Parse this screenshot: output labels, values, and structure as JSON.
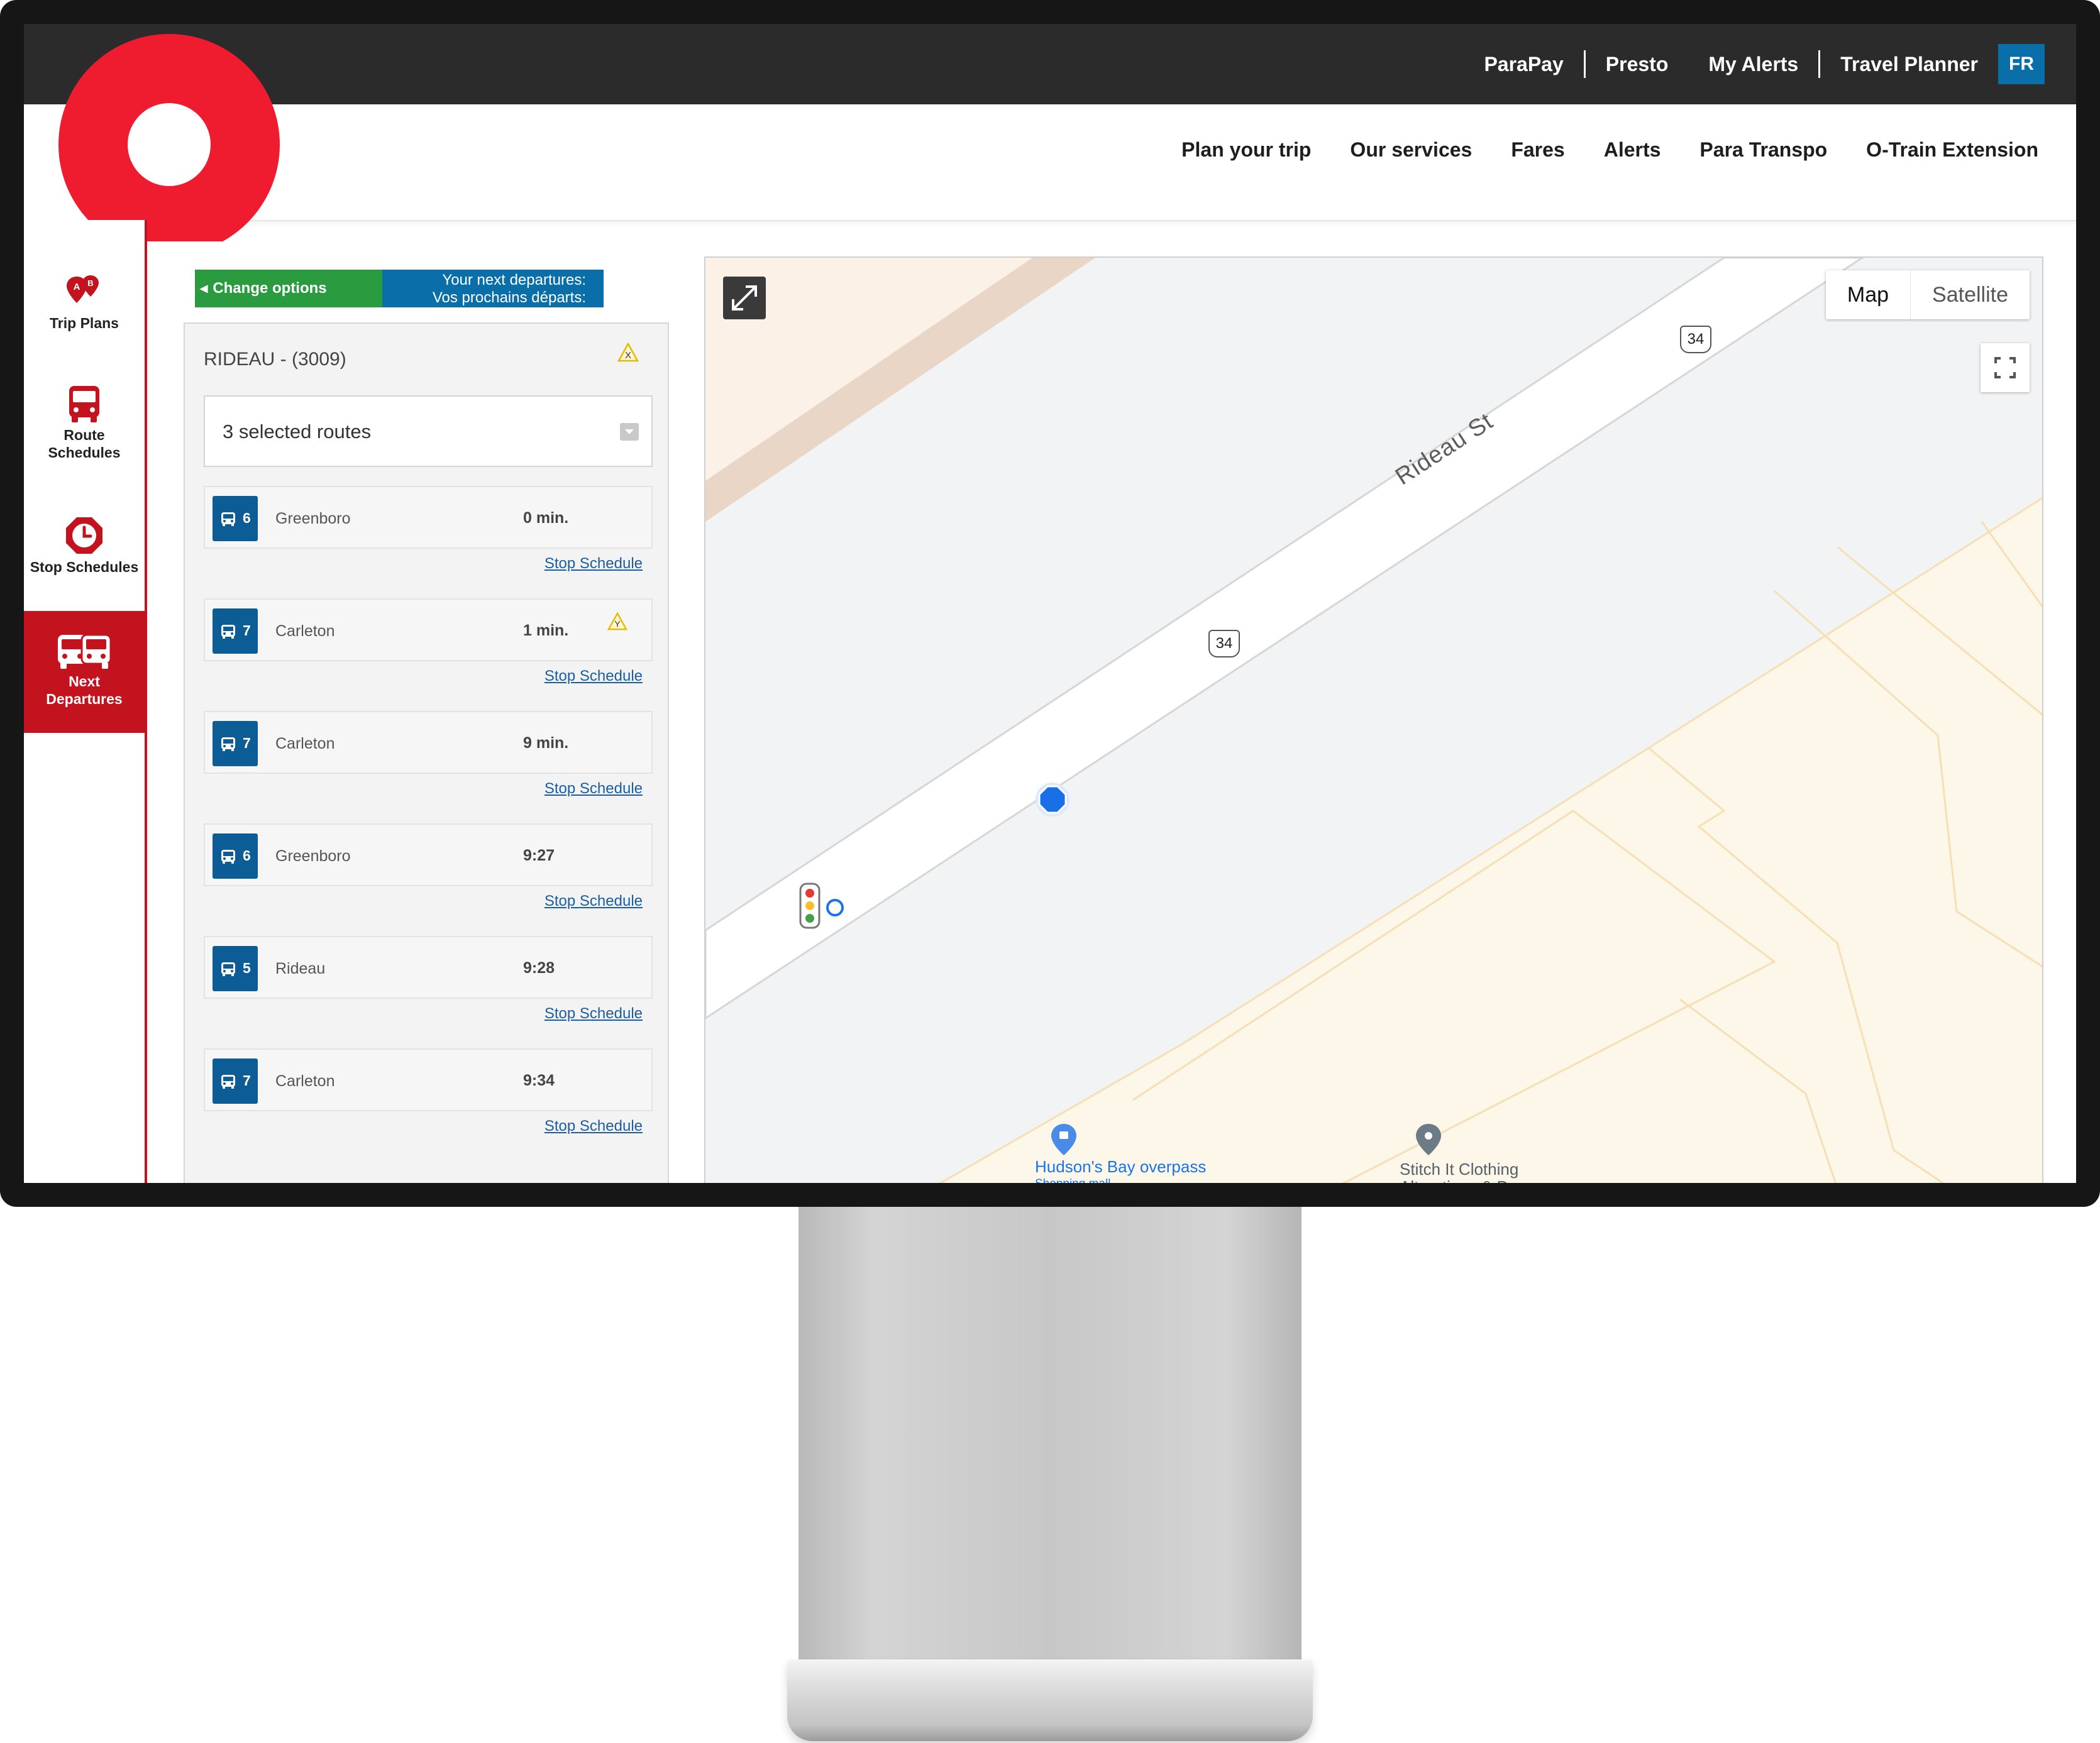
{
  "top_links": [
    "ParaPay",
    "Presto",
    "My Alerts",
    "Travel Planner"
  ],
  "lang_button": "FR",
  "main_nav": [
    "Plan your trip",
    "Our services",
    "Fares",
    "Alerts",
    "Para Transpo",
    "O-Train Extension"
  ],
  "sidebar": {
    "trip_plans": "Trip Plans",
    "route_schedules_1": "Route",
    "route_schedules_2": "Schedules",
    "stop_schedules": "Stop Schedules",
    "next_departures_1": "Next",
    "next_departures_2": "Departures"
  },
  "tabs": {
    "change_options": "Change options",
    "next_departures_en": "Your next departures:",
    "next_departures_fr": "Vos prochains départs:"
  },
  "stop": {
    "title": "RIDEAU - (3009)",
    "selected_routes": "3 selected routes"
  },
  "departures": [
    {
      "route": "6",
      "destination": "Greenboro",
      "time": "0 min.",
      "link": "Stop Schedule",
      "warn": false
    },
    {
      "route": "7",
      "destination": "Carleton",
      "time": "1 min.",
      "link": "Stop Schedule",
      "warn": true
    },
    {
      "route": "7",
      "destination": "Carleton",
      "time": "9 min.",
      "link": "Stop Schedule",
      "warn": false
    },
    {
      "route": "6",
      "destination": "Greenboro",
      "time": "9:27",
      "link": "Stop Schedule",
      "warn": false
    },
    {
      "route": "5",
      "destination": "Rideau",
      "time": "9:28",
      "link": "Stop Schedule",
      "warn": false
    },
    {
      "route": "7",
      "destination": "Carleton",
      "time": "9:34",
      "link": "Stop Schedule",
      "warn": false
    }
  ],
  "map": {
    "type_map": "Map",
    "type_satellite": "Satellite",
    "street": "Rideau St",
    "route_shield": "34",
    "poi1_name": "Hudson's Bay overpass",
    "poi1_sub": "Shopping mall",
    "poi2_name": "Stitch It Clothing",
    "poi2_sub": "Alterations & Dry..."
  },
  "colors": {
    "brand_red": "#ef1b2f",
    "sidebar_active": "#c3131f",
    "tab_green": "#2a9c3f",
    "tab_blue": "#0a6fa8",
    "route_badge": "#0c5c96",
    "link_blue": "#1b5fa1"
  }
}
